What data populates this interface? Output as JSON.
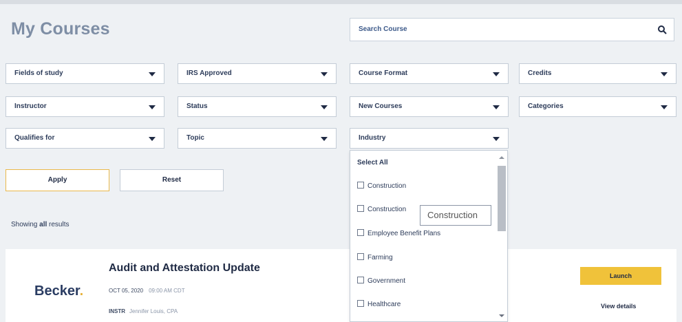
{
  "page": {
    "title": "My Courses"
  },
  "search": {
    "placeholder": "Search Course"
  },
  "filters": [
    {
      "label": "Fields of study"
    },
    {
      "label": "IRS Approved"
    },
    {
      "label": "Course Format"
    },
    {
      "label": "Credits"
    },
    {
      "label": "Instructor"
    },
    {
      "label": "Status"
    },
    {
      "label": "New Courses"
    },
    {
      "label": "Categories"
    },
    {
      "label": "Qualifies for"
    },
    {
      "label": "Topic"
    },
    {
      "label": "Industry"
    }
  ],
  "buttons": {
    "apply": "Apply",
    "reset": "Reset"
  },
  "results": {
    "prefix": "Showing ",
    "strong": "all",
    "suffix": " results"
  },
  "industry_dropdown": {
    "select_all": "Select All",
    "options": [
      "Construction",
      "Construction",
      "Employee Benefit Plans",
      "Farming",
      "Government",
      "Healthcare"
    ],
    "tooltip": "Construction"
  },
  "course": {
    "logo_text": "Becker",
    "logo_dot": ".",
    "title": "Audit and Attestation Update",
    "date": "OCT 05, 2020",
    "time": "09:00 AM CDT",
    "instructor_label": "INSTR",
    "instructor_name": "Jennifer Louis, CPA",
    "launch": "Launch",
    "view_details": "View details"
  },
  "colors": {
    "accent": "#f0c23a",
    "title": "#7e8ea5",
    "navy": "#1f2a44"
  }
}
